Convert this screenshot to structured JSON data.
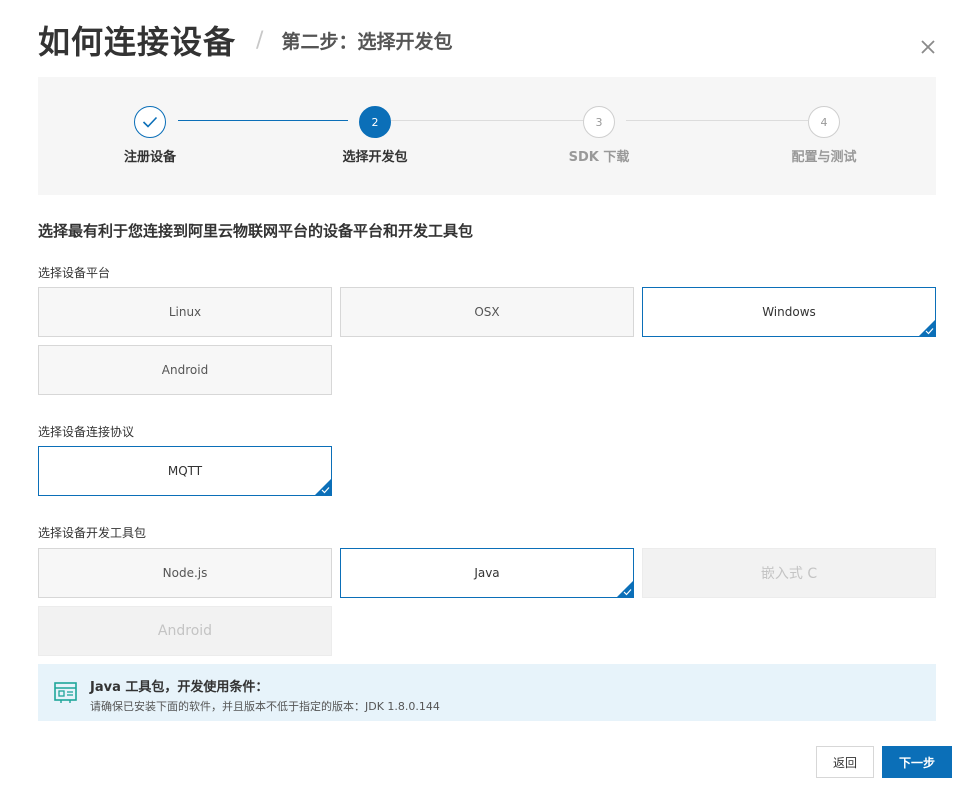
{
  "header": {
    "title": "如何连接设备",
    "separator": "/",
    "subtitle": "第二步：选择开发包"
  },
  "steps": [
    {
      "number": "1",
      "label": "注册设备",
      "state": "done"
    },
    {
      "number": "2",
      "label": "选择开发包",
      "state": "active"
    },
    {
      "number": "3",
      "label": "SDK 下载",
      "state": "todo"
    },
    {
      "number": "4",
      "label": "配置与测试",
      "state": "todo"
    }
  ],
  "intro": "选择最有利于您连接到阿里云物联网平台的设备平台和开发工具包",
  "platform": {
    "label": "选择设备平台",
    "options": [
      {
        "label": "Linux",
        "state": "normal"
      },
      {
        "label": "OSX",
        "state": "normal"
      },
      {
        "label": "Windows",
        "state": "selected"
      },
      {
        "label": "Android",
        "state": "normal"
      }
    ]
  },
  "protocol": {
    "label": "选择设备连接协议",
    "options": [
      {
        "label": "MQTT",
        "state": "selected"
      }
    ]
  },
  "sdk": {
    "label": "选择设备开发工具包",
    "options": [
      {
        "label": "Node.js",
        "state": "normal"
      },
      {
        "label": "Java",
        "state": "selected"
      },
      {
        "label": "嵌入式 C",
        "state": "disabled"
      },
      {
        "label": "Android",
        "state": "disabled"
      }
    ]
  },
  "info": {
    "title_prefix": "Java",
    "title_rest": " 工具包，开发使用条件：",
    "text": "请确保已安装下面的软件，并且版本不低于指定的版本：JDK 1.8.0.144",
    "icon": "toolkit-icon"
  },
  "footer": {
    "back_label": "返回",
    "next_label": "下一步"
  },
  "colors": {
    "accent": "#0b6fb8",
    "info_bg": "#e7f3fa",
    "icon_teal": "#1fa69a"
  }
}
